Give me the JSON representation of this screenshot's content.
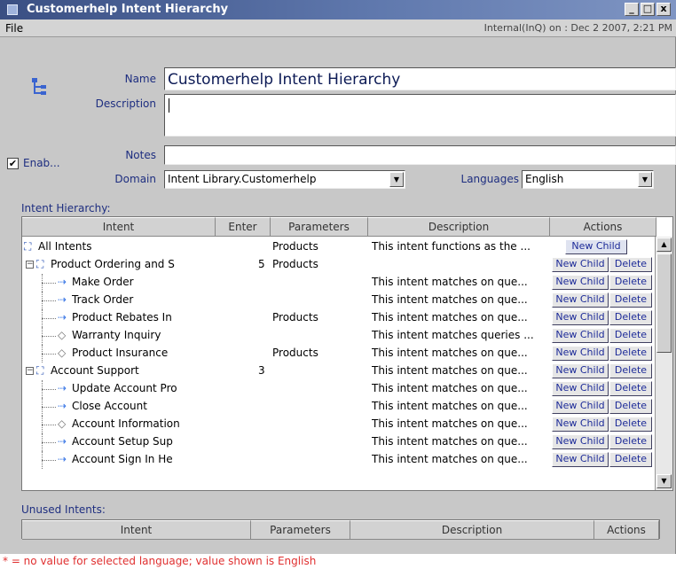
{
  "window": {
    "title": "Customerhelp Intent Hierarchy",
    "minimize": "_",
    "maximize": "□",
    "close": "x"
  },
  "menubar": {
    "file": "File",
    "info": "Internal(InQ) on : Dec 2 2007, 2:21 PM"
  },
  "form": {
    "name_label": "Name",
    "name_value": "Customerhelp Intent Hierarchy",
    "description_label": "Description",
    "description_value": "",
    "notes_label": "Notes",
    "notes_value": "",
    "enabled_label": "Enab...",
    "enabled_checked": "✔",
    "domain_label": "Domain",
    "domain_value": "Intent Library.Customerhelp",
    "languages_label": "Languages",
    "languages_value": "English"
  },
  "hierarchy": {
    "section_label": "Intent Hierarchy:",
    "columns": [
      "Intent",
      "Enter",
      "Parameters",
      "Description",
      "Actions"
    ],
    "rows": [
      {
        "intent": "All Intents",
        "enter": "",
        "params": "Products",
        "desc": "This intent functions as the ...",
        "actions": [
          "New Child"
        ],
        "level": 0,
        "icon": "folder"
      },
      {
        "intent": "Product Ordering and S",
        "enter": "5",
        "params": "Products",
        "desc": "",
        "actions": [
          "New Child",
          "Delete"
        ],
        "level": 1,
        "icon": "folder"
      },
      {
        "intent": "Make Order",
        "enter": "",
        "params": "",
        "desc": "This intent matches on que...",
        "actions": [
          "New Child",
          "Delete"
        ],
        "level": 2,
        "icon": "arrow"
      },
      {
        "intent": "Track Order",
        "enter": "",
        "params": "",
        "desc": "This intent matches on que...",
        "actions": [
          "New Child",
          "Delete"
        ],
        "level": 2,
        "icon": "arrow"
      },
      {
        "intent": "Product Rebates In",
        "enter": "",
        "params": "Products",
        "desc": "This intent matches on que...",
        "actions": [
          "New Child",
          "Delete"
        ],
        "level": 2,
        "icon": "arrow"
      },
      {
        "intent": "Warranty Inquiry",
        "enter": "",
        "params": "",
        "desc": "This intent matches queries ...",
        "actions": [
          "New Child",
          "Delete"
        ],
        "level": 2,
        "icon": "diamond"
      },
      {
        "intent": "Product Insurance",
        "enter": "",
        "params": "Products",
        "desc": "This intent matches on que...",
        "actions": [
          "New Child",
          "Delete"
        ],
        "level": 2,
        "icon": "diamond"
      },
      {
        "intent": "Account Support",
        "enter": "3",
        "params": "",
        "desc": "This intent matches on que...",
        "actions": [
          "New Child",
          "Delete"
        ],
        "level": 1,
        "icon": "folder"
      },
      {
        "intent": "Update Account Pro",
        "enter": "",
        "params": "",
        "desc": "This intent matches on que...",
        "actions": [
          "New Child",
          "Delete"
        ],
        "level": 2,
        "icon": "arrow"
      },
      {
        "intent": "Close Account",
        "enter": "",
        "params": "",
        "desc": "This intent matches on que...",
        "actions": [
          "New Child",
          "Delete"
        ],
        "level": 2,
        "icon": "arrow"
      },
      {
        "intent": "Account Information",
        "enter": "",
        "params": "",
        "desc": "This intent matches on que...",
        "actions": [
          "New Child",
          "Delete"
        ],
        "level": 2,
        "icon": "diamond"
      },
      {
        "intent": "Account Setup Sup",
        "enter": "",
        "params": "",
        "desc": "This intent matches on que...",
        "actions": [
          "New Child",
          "Delete"
        ],
        "level": 2,
        "icon": "arrow"
      },
      {
        "intent": "Account Sign In He",
        "enter": "",
        "params": "",
        "desc": "This intent matches on que...",
        "actions": [
          "New Child",
          "Delete"
        ],
        "level": 2,
        "icon": "arrow"
      }
    ]
  },
  "unused": {
    "section_label": "Unused Intents:",
    "columns": [
      "Intent",
      "Parameters",
      "Description",
      "Actions"
    ]
  },
  "footer": {
    "note": "* = no value for selected language; value shown is English"
  },
  "icons": {
    "folder": "folder-tree-icon",
    "arrow": "intent-arrow-icon",
    "diamond": "intent-diamond-icon"
  }
}
